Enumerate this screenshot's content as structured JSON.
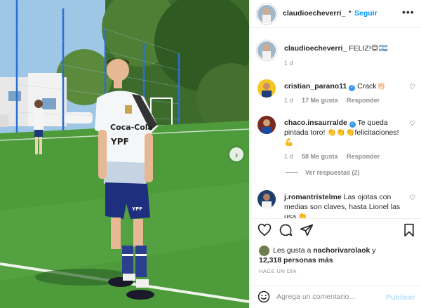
{
  "post": {
    "username": "claudioecheverri_",
    "follow_label": "Seguir",
    "separator": "•",
    "more_label": "•••"
  },
  "caption": {
    "username": "claudioecheverri_",
    "text": "FELIZ!😊🇦🇷",
    "time": "1 d"
  },
  "comments": [
    {
      "username": "cristian_parano11",
      "verified": true,
      "text": "Crack👏🏻",
      "time": "1 d",
      "likes": "17 Me gusta",
      "reply": "Responder"
    },
    {
      "username": "chaco.insaurralde",
      "verified": true,
      "text": "Te queda pintada toro! 👏👏👏felicitaciones! 💪",
      "time": "1 d",
      "likes": "58 Me gusta",
      "reply": "Responder",
      "replies_label": "Ver respuestas (2)"
    },
    {
      "username": "j.romantristelme",
      "verified": false,
      "text": "Las ojotas con medias son claves, hasta Lionel las usa 👏"
    }
  ],
  "liked_by": {
    "prefix": "Les gusta a",
    "user": "nachorivarolaok",
    "middle": "y",
    "count": "12,318 personas más"
  },
  "time_ago": "HACE UN DÍA",
  "add_comment": {
    "placeholder": "Agrega un comentario...",
    "post_label": "Publicar"
  },
  "colors": {
    "accent": "#0095f6",
    "post_disabled": "#b2dffc",
    "secondary_text": "#8e8e8e"
  },
  "icons": [
    "heart-icon",
    "comment-icon",
    "share-icon",
    "bookmark-icon",
    "emoji-icon",
    "chevron-right-icon",
    "verified-icon"
  ]
}
